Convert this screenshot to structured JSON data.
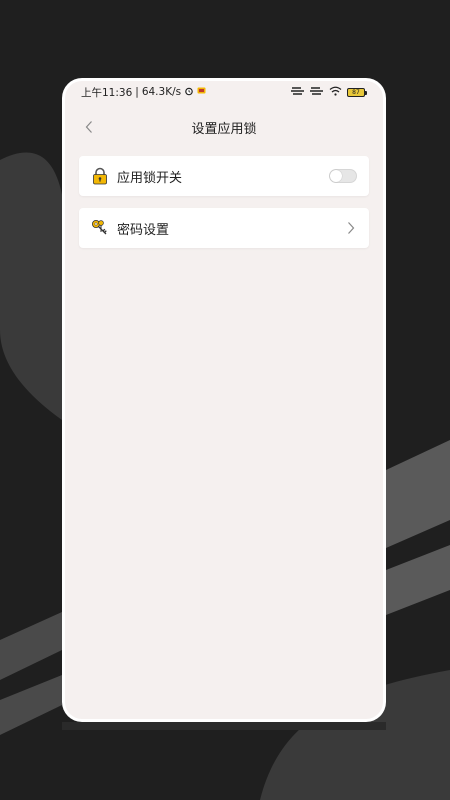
{
  "status_bar": {
    "time": "上午11:36",
    "speed": "64.3K/s",
    "battery": "87"
  },
  "header": {
    "title": "设置应用锁"
  },
  "items": [
    {
      "label": "应用锁开关",
      "icon": "lock-icon",
      "control": "toggle",
      "enabled": false
    },
    {
      "label": "密码设置",
      "icon": "key-icon",
      "control": "chevron"
    }
  ],
  "colors": {
    "background": "#1f1f1f",
    "screen": "#f5f0ef",
    "card": "#ffffff",
    "accent": "#f2b705"
  }
}
